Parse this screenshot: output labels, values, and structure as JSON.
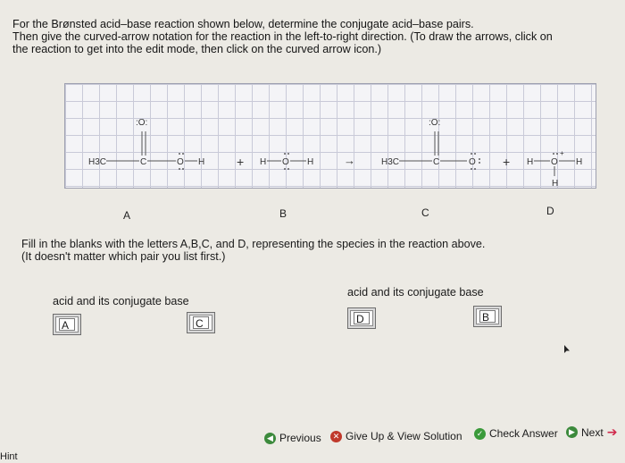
{
  "instructions": {
    "line1": "For the Brønsted acid–base reaction shown below, determine the conjugate acid–base pairs.",
    "line2": "Then give the curved-arrow notation for the reaction in the left-to-right direction. (To draw the arrows, click on",
    "line3": "the reaction to  get into the edit mode, then click on the curved arrow icon.)"
  },
  "reaction": {
    "h3c_1": "H3C",
    "c_1": "C",
    "o_top_1": ":O:",
    "o_mid_1": "O",
    "h_1": "H",
    "plus_1": "+",
    "h_2": "H",
    "o_water": "O",
    "h_3": "H",
    "arrow": "→",
    "h3c_2": "H3C",
    "c_2": "C",
    "o_top_2": ":O:",
    "o_anion": "O",
    "plus_2": "+",
    "h_4": "H",
    "o_hydronium": "O",
    "charge": "+",
    "h_5": "H",
    "h_6": "H"
  },
  "species_labels": [
    "A",
    "B",
    "C",
    "D"
  ],
  "fill": {
    "line1": "Fill in the blanks with the letters A,B,C, and D, representing the species in the reaction above.",
    "line2": "(It doesn't matter which pair you list first.)"
  },
  "pairs": [
    {
      "label": "acid and its conjugate base",
      "acid": "A",
      "base": "C"
    },
    {
      "label": "acid and its conjugate base",
      "acid": "D",
      "base": "B"
    }
  ],
  "nav": {
    "previous": "Previous",
    "give_up": "Give Up & View Solution",
    "check": "Check Answer",
    "next": "Next"
  },
  "hint": "Hint",
  "colors": {
    "previous_icon": "#3c8a3c",
    "giveup_icon": "#c0392b",
    "check_icon": "#3a9a3a",
    "next_icon": "#3c8a3c",
    "next_arrow": "#d0284a"
  }
}
